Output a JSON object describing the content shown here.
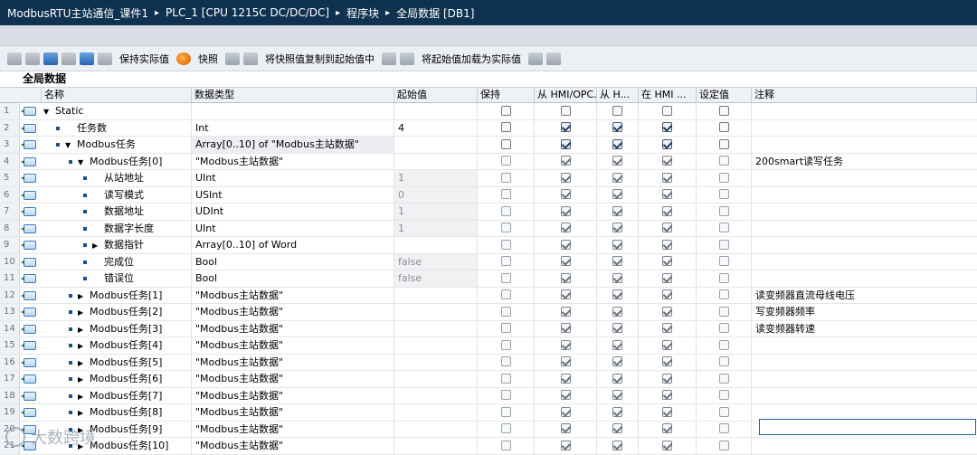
{
  "breadcrumb": [
    "ModbusRTU主站通信_课件1",
    "PLC_1 [CPU 1215C DC/DC/DC]",
    "程序块",
    "全局数据 [DB1]"
  ],
  "breadcrumb_sep": "▸",
  "toolbar": {
    "keep_actual": "保持实际值",
    "snapshot": "快照",
    "copy_snapshot": "将快照值复制到起始值中",
    "load_start": "将起始值加载为实际值"
  },
  "block_title": "全局数据",
  "columns": {
    "name": "名称",
    "type": "数据类型",
    "start": "起始值",
    "retain": "保持",
    "hmi1": "从 HMI/OPC...",
    "hmi2": "从 H...",
    "hmi3": "在 HMI ...",
    "setpoint": "设定值",
    "comment": "注释"
  },
  "rows": [
    {
      "n": "1",
      "level": 0,
      "expand": "▼",
      "icon": true,
      "dot": false,
      "name": "Static",
      "type": "",
      "start": "",
      "cb": [
        0,
        0,
        0,
        0,
        0
      ],
      "en": false,
      "comment": ""
    },
    {
      "n": "2",
      "level": 1,
      "expand": "",
      "icon": true,
      "dot": true,
      "name": "任务数",
      "type": "Int",
      "start": "4",
      "cb": [
        0,
        1,
        1,
        1,
        0
      ],
      "en": true,
      "comment": ""
    },
    {
      "n": "3",
      "level": 1,
      "expand": "▼",
      "icon": true,
      "dot": true,
      "name": "Modbus任务",
      "type": "Array[0..10] of \"Modbus主站数据\"",
      "start": "",
      "cb": [
        0,
        1,
        1,
        1,
        0
      ],
      "en": true,
      "comment": ""
    },
    {
      "n": "4",
      "level": 2,
      "expand": "▼",
      "icon": true,
      "dot": true,
      "name": "Modbus任务[0]",
      "type": "\"Modbus主站数据\"",
      "start": "",
      "cb": [
        0,
        1,
        1,
        1,
        0
      ],
      "en": false,
      "comment": "200smart读写任务"
    },
    {
      "n": "5",
      "level": 3,
      "expand": "",
      "icon": true,
      "dot": true,
      "name": "从站地址",
      "type": "UInt",
      "start": "1",
      "cb": [
        0,
        1,
        1,
        1,
        0
      ],
      "en": false,
      "comment": ""
    },
    {
      "n": "6",
      "level": 3,
      "expand": "",
      "icon": true,
      "dot": true,
      "name": "读写模式",
      "type": "USInt",
      "start": "0",
      "cb": [
        0,
        1,
        1,
        1,
        0
      ],
      "en": false,
      "comment": ""
    },
    {
      "n": "7",
      "level": 3,
      "expand": "",
      "icon": true,
      "dot": true,
      "name": "数据地址",
      "type": "UDInt",
      "start": "1",
      "cb": [
        0,
        1,
        1,
        1,
        0
      ],
      "en": false,
      "comment": ""
    },
    {
      "n": "8",
      "level": 3,
      "expand": "",
      "icon": true,
      "dot": true,
      "name": "数据字长度",
      "type": "UInt",
      "start": "1",
      "cb": [
        0,
        1,
        1,
        1,
        0
      ],
      "en": false,
      "comment": ""
    },
    {
      "n": "9",
      "level": 3,
      "expand": "▶",
      "icon": true,
      "dot": true,
      "name": "数据指针",
      "type": "Array[0..10] of Word",
      "start": "",
      "cb": [
        0,
        1,
        1,
        1,
        0
      ],
      "en": false,
      "comment": ""
    },
    {
      "n": "10",
      "level": 3,
      "expand": "",
      "icon": true,
      "dot": true,
      "name": "完成位",
      "type": "Bool",
      "start": "false",
      "cb": [
        0,
        1,
        1,
        1,
        0
      ],
      "en": false,
      "comment": ""
    },
    {
      "n": "11",
      "level": 3,
      "expand": "",
      "icon": true,
      "dot": true,
      "name": "错误位",
      "type": "Bool",
      "start": "false",
      "cb": [
        0,
        1,
        1,
        1,
        0
      ],
      "en": false,
      "comment": ""
    },
    {
      "n": "12",
      "level": 2,
      "expand": "▶",
      "icon": true,
      "dot": true,
      "name": "Modbus任务[1]",
      "type": "\"Modbus主站数据\"",
      "start": "",
      "cb": [
        0,
        1,
        1,
        1,
        0
      ],
      "en": false,
      "comment": "读变频器直流母线电压"
    },
    {
      "n": "13",
      "level": 2,
      "expand": "▶",
      "icon": true,
      "dot": true,
      "name": "Modbus任务[2]",
      "type": "\"Modbus主站数据\"",
      "start": "",
      "cb": [
        0,
        1,
        1,
        1,
        0
      ],
      "en": false,
      "comment": "写变频器频率"
    },
    {
      "n": "14",
      "level": 2,
      "expand": "▶",
      "icon": true,
      "dot": true,
      "name": "Modbus任务[3]",
      "type": "\"Modbus主站数据\"",
      "start": "",
      "cb": [
        0,
        1,
        1,
        1,
        0
      ],
      "en": false,
      "comment": "读变频器转速"
    },
    {
      "n": "15",
      "level": 2,
      "expand": "▶",
      "icon": true,
      "dot": true,
      "name": "Modbus任务[4]",
      "type": "\"Modbus主站数据\"",
      "start": "",
      "cb": [
        0,
        1,
        1,
        1,
        0
      ],
      "en": false,
      "comment": ""
    },
    {
      "n": "16",
      "level": 2,
      "expand": "▶",
      "icon": true,
      "dot": true,
      "name": "Modbus任务[5]",
      "type": "\"Modbus主站数据\"",
      "start": "",
      "cb": [
        0,
        1,
        1,
        1,
        0
      ],
      "en": false,
      "comment": ""
    },
    {
      "n": "17",
      "level": 2,
      "expand": "▶",
      "icon": true,
      "dot": true,
      "name": "Modbus任务[6]",
      "type": "\"Modbus主站数据\"",
      "start": "",
      "cb": [
        0,
        1,
        1,
        1,
        0
      ],
      "en": false,
      "comment": ""
    },
    {
      "n": "18",
      "level": 2,
      "expand": "▶",
      "icon": true,
      "dot": true,
      "name": "Modbus任务[7]",
      "type": "\"Modbus主站数据\"",
      "start": "",
      "cb": [
        0,
        1,
        1,
        1,
        0
      ],
      "en": false,
      "comment": ""
    },
    {
      "n": "19",
      "level": 2,
      "expand": "▶",
      "icon": true,
      "dot": true,
      "name": "Modbus任务[8]",
      "type": "\"Modbus主站数据\"",
      "start": "",
      "cb": [
        0,
        1,
        1,
        1,
        0
      ],
      "en": false,
      "comment": ""
    },
    {
      "n": "20",
      "level": 2,
      "expand": "▶",
      "icon": true,
      "dot": true,
      "name": "Modbus任务[9]",
      "type": "\"Modbus主站数据\"",
      "start": "",
      "cb": [
        0,
        1,
        1,
        1,
        0
      ],
      "en": false,
      "comment": ""
    },
    {
      "n": "21",
      "level": 2,
      "expand": "▶",
      "icon": true,
      "dot": true,
      "name": "Modbus任务[10]",
      "type": "\"Modbus主站数据\"",
      "start": "",
      "cb": [
        0,
        1,
        1,
        1,
        0
      ],
      "en": false,
      "comment": ""
    }
  ],
  "watermark": "大数跨境"
}
